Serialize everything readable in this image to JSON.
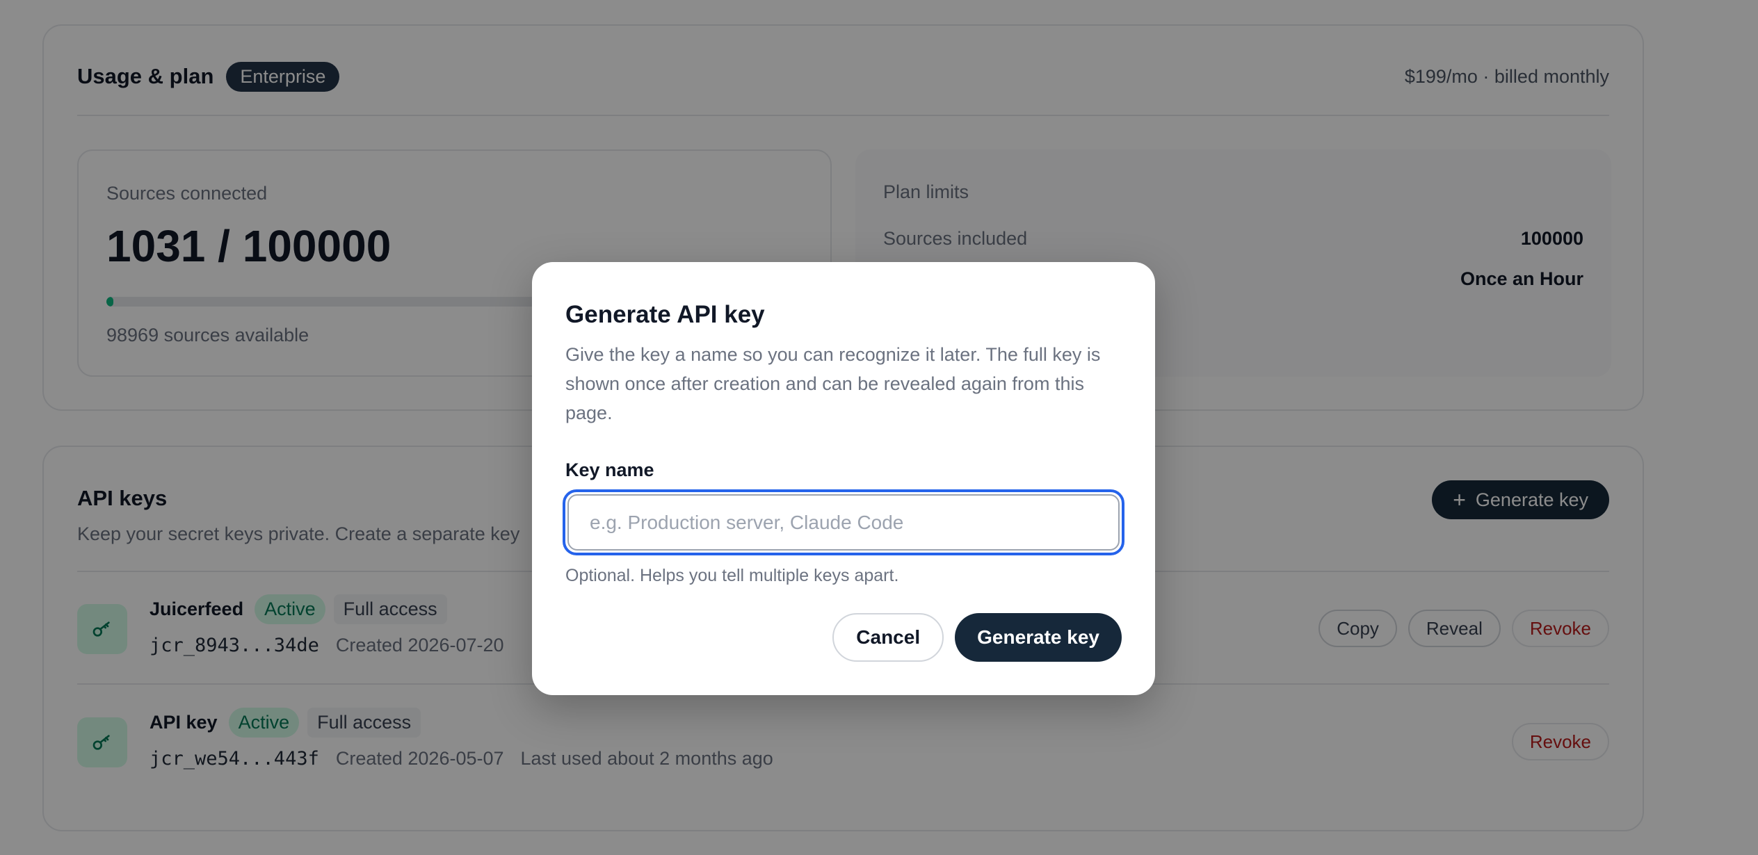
{
  "usage": {
    "title": "Usage & plan",
    "plan_badge": "Enterprise",
    "billing": "$199/mo · billed monthly",
    "sources_label": "Sources connected",
    "sources_count": "1031 / 100000",
    "sources_progress_fraction": 0.0103,
    "sources_available": "98969 sources available",
    "limits_title": "Plan limits",
    "limits": [
      {
        "label": "Sources included",
        "value": "100000"
      },
      {
        "label": "",
        "value": "Once an Hour"
      }
    ]
  },
  "api_keys": {
    "title": "API keys",
    "description": "Keep your secret keys private. Create a separate key",
    "generate_label": "Generate key",
    "generate_icon": "plus-icon",
    "keys": [
      {
        "name": "Juicerfeed",
        "status": "Active",
        "scope": "Full access",
        "value": "jcr_8943...34de",
        "created": "Created 2026-07-20",
        "last_used": "",
        "actions": [
          "Copy",
          "Reveal",
          "Revoke"
        ]
      },
      {
        "name": "API key",
        "status": "Active",
        "scope": "Full access",
        "value": "jcr_we54...443f",
        "created": "Created 2026-05-07",
        "last_used": "Last used about 2 months ago",
        "actions": [
          "Revoke"
        ]
      }
    ]
  },
  "modal": {
    "title": "Generate API key",
    "description": "Give the key a name so you can recognize it later. The full key is shown once after creation and can be revealed again from this page.",
    "field_label": "Key name",
    "field_placeholder": "e.g. Production server, Claude Code",
    "field_value": "",
    "field_help": "Optional. Helps you tell multiple keys apart.",
    "cancel_label": "Cancel",
    "confirm_label": "Generate key"
  },
  "colors": {
    "accent_dark": "#16283a",
    "focus_ring": "#2563eb",
    "status_green": "#047857",
    "danger": "#b91c1c"
  }
}
